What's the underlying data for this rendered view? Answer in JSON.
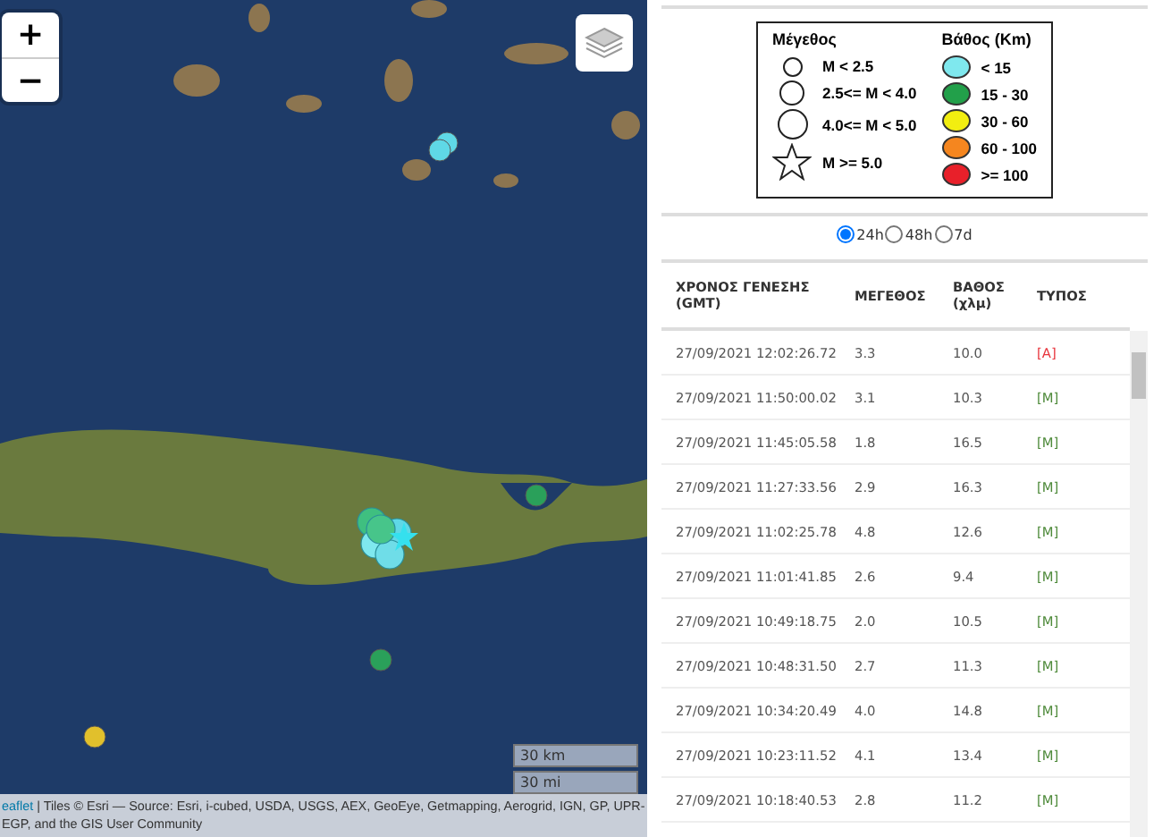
{
  "map": {
    "zoom_in": "+",
    "zoom_out": "−",
    "scale": [
      "30 km",
      "30 mi"
    ],
    "attribution_link": "eaflet",
    "attribution": " | Tiles © Esri — Source: Esri, i-cubed, USDA, USGS, AEX, GeoEye, Getmapping, Aerogrid, IGN, GP, UPR-EGP, and the GIS User Community"
  },
  "legend": {
    "magnitude_title": "Μέγεθος",
    "magnitudes": [
      {
        "kind": "small",
        "label": "M < 2.5"
      },
      {
        "kind": "medium",
        "label": "2.5<= M < 4.0"
      },
      {
        "kind": "large",
        "label": "4.0<= M < 5.0"
      },
      {
        "kind": "star",
        "label": "M >= 5.0"
      }
    ],
    "depth_title": "Βάθος (Km)",
    "depths": [
      {
        "color": "#7fe8ee",
        "label": "< 15"
      },
      {
        "color": "#22a04a",
        "label": "15 - 30"
      },
      {
        "color": "#f2ee10",
        "label": "30 - 60"
      },
      {
        "color": "#f5861f",
        "label": "60 - 100"
      },
      {
        "color": "#e8202a",
        "label": ">= 100"
      }
    ]
  },
  "periods": [
    {
      "label": "24h",
      "selected": true
    },
    {
      "label": "48h",
      "selected": false
    },
    {
      "label": "7d",
      "selected": false
    }
  ],
  "table": {
    "columns": [
      "ΧΡΟΝΟΣ ΓΕΝΕΣΗΣ (GMT)",
      "ΜΕΓΕΘΟΣ",
      "ΒΑΘΟΣ (χλμ)",
      "ΤΥΠΟΣ"
    ],
    "rows": [
      {
        "time": "27/09/2021 12:02:26.72",
        "magnitude": "3.3",
        "depth": "10.0",
        "type": "[A]",
        "color": "#e8343c"
      },
      {
        "time": "27/09/2021 11:50:00.02",
        "magnitude": "3.1",
        "depth": "10.3",
        "type": "[M]",
        "color": "#4e8a3a"
      },
      {
        "time": "27/09/2021 11:45:05.58",
        "magnitude": "1.8",
        "depth": "16.5",
        "type": "[M]",
        "color": "#4e8a3a"
      },
      {
        "time": "27/09/2021 11:27:33.56",
        "magnitude": "2.9",
        "depth": "16.3",
        "type": "[M]",
        "color": "#4e8a3a"
      },
      {
        "time": "27/09/2021 11:02:25.78",
        "magnitude": "4.8",
        "depth": "12.6",
        "type": "[M]",
        "color": "#4e8a3a"
      },
      {
        "time": "27/09/2021 11:01:41.85",
        "magnitude": "2.6",
        "depth": "9.4",
        "type": "[M]",
        "color": "#4e8a3a"
      },
      {
        "time": "27/09/2021 10:49:18.75",
        "magnitude": "2.0",
        "depth": "10.5",
        "type": "[M]",
        "color": "#4e8a3a"
      },
      {
        "time": "27/09/2021 10:48:31.50",
        "magnitude": "2.7",
        "depth": "11.3",
        "type": "[M]",
        "color": "#4e8a3a"
      },
      {
        "time": "27/09/2021 10:34:20.49",
        "magnitude": "4.0",
        "depth": "14.8",
        "type": "[M]",
        "color": "#4e8a3a"
      },
      {
        "time": "27/09/2021 10:23:11.52",
        "magnitude": "4.1",
        "depth": "13.4",
        "type": "[M]",
        "color": "#4e8a3a"
      },
      {
        "time": "27/09/2021 10:18:40.53",
        "magnitude": "2.8",
        "depth": "11.2",
        "type": "[M]",
        "color": "#4e8a3a"
      }
    ]
  }
}
